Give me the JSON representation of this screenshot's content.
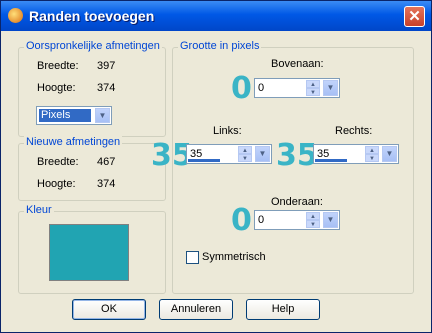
{
  "window": {
    "title": "Randen toevoegen",
    "close_glyph": "✕"
  },
  "original": {
    "legend": "Oorspronkelijke afmetingen",
    "width_label": "Breedte:",
    "width_value": "397",
    "height_label": "Hoogte:",
    "height_value": "374",
    "unit": "Pixels"
  },
  "new": {
    "legend": "Nieuwe afmetingen",
    "width_label": "Breedte:",
    "width_value": "467",
    "height_label": "Hoogte:",
    "height_value": "374"
  },
  "color": {
    "legend": "Kleur",
    "value": "#21a4b2"
  },
  "size": {
    "legend": "Grootte in pixels",
    "top": {
      "label": "Bovenaan:",
      "value": "0",
      "big": "0"
    },
    "left": {
      "label": "Links:",
      "value": "35",
      "big": "35"
    },
    "right": {
      "label": "Rechts:",
      "value": "35",
      "big": "35"
    },
    "bottom": {
      "label": "Onderaan:",
      "value": "0",
      "big": "0"
    },
    "symmetric_label": "Symmetrisch",
    "symmetric_checked": false
  },
  "buttons": {
    "ok": "OK",
    "cancel": "Annuleren",
    "help": "Help"
  },
  "icons": {
    "app": "paint-shop-icon",
    "dropdown": "chevron-down-icon",
    "spin": "up-down-arrows-icon"
  }
}
